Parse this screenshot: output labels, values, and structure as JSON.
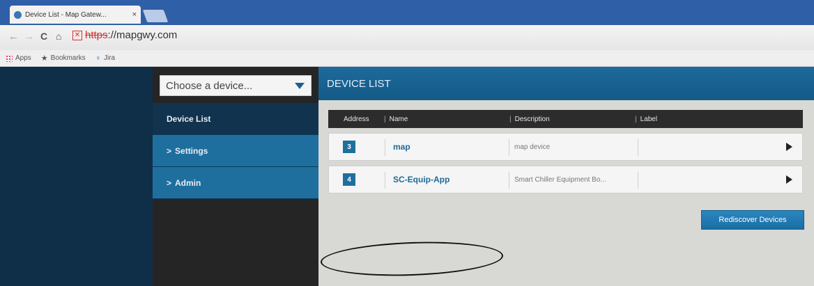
{
  "browser": {
    "tab_title": "Device List - Map Gatew...",
    "tab_close": "×",
    "url_protocol": "https",
    "url_host": "://mapgwy.com",
    "bookmarks": [
      {
        "label": "Apps",
        "icon": "apps-icon"
      },
      {
        "label": "Bookmarks",
        "icon": "star-icon"
      },
      {
        "label": "Jira",
        "icon": "jira-icon"
      }
    ]
  },
  "sidebar": {
    "device_select_placeholder": "Choose a device...",
    "menu": [
      {
        "label": "Device List",
        "active": true
      },
      {
        "label": "Settings",
        "prefix": ">"
      },
      {
        "label": "Admin",
        "prefix": ">"
      }
    ]
  },
  "main": {
    "title": "DEVICE LIST",
    "columns": [
      "Address",
      "Name",
      "Description",
      "Label"
    ],
    "rows": [
      {
        "address": "3",
        "name": "map",
        "description": "map device",
        "label": ""
      },
      {
        "address": "4",
        "name": "SC-Equip-App",
        "description": "Smart Chiller Equipment Bo...",
        "label": ""
      }
    ],
    "rediscover_label": "Rediscover Devices"
  },
  "colors": {
    "accent": "#1f6f9e",
    "header_bg": "#2c2c2c",
    "rail_bg": "#0f2f49"
  }
}
